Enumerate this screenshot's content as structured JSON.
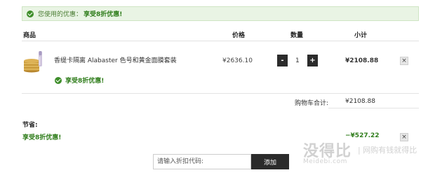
{
  "notice": {
    "text": "您使用的优惠：",
    "strong": "享受8折优惠!"
  },
  "table_header": {
    "product": "商品",
    "price": "价格",
    "quantity": "数量",
    "subtotal": "小计"
  },
  "item": {
    "title": "香缇卡隔离 Alabaster 色号和黄金面膜套装",
    "price": "¥2636.10",
    "quantity": "1",
    "minus": "-",
    "plus": "+",
    "subtotal": "¥2108.88",
    "remove": "×",
    "discount": "享受8折优惠!"
  },
  "cart_total": {
    "label": "购物车合计:",
    "value": "¥2108.88"
  },
  "savings": {
    "title": "节省:",
    "name": "享受8折优惠!",
    "amount": "−¥527.22",
    "remove": "×"
  },
  "coupon": {
    "placeholder": "请输入折扣代码:",
    "button": "添加"
  },
  "watermark": {
    "chars": "没得比",
    "tag": "| 网购有钱就得比",
    "domain": "Meidebi.com"
  }
}
